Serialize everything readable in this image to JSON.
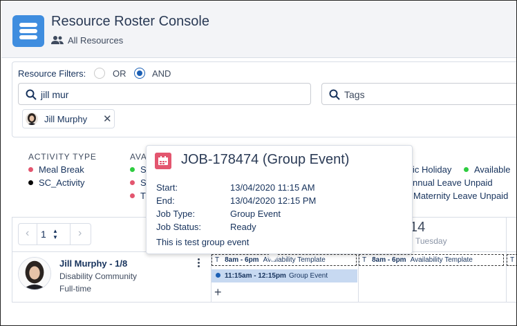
{
  "header": {
    "title": "Resource Roster Console",
    "subtitle": "All Resources"
  },
  "filters": {
    "label": "Resource Filters:",
    "options": [
      {
        "label": "OR",
        "selected": false
      },
      {
        "label": "AND",
        "selected": true
      }
    ],
    "search": {
      "value": "jill mur"
    },
    "tags": {
      "placeholder": "Tags"
    },
    "selected_resource": "Jill Murphy"
  },
  "legend": {
    "activity_type_heading": "ACTIVITY TYPE",
    "activity_types": [
      {
        "label": "Meal Break",
        "color": "#e3566f"
      },
      {
        "label": "SC_Activity",
        "color": "#080707"
      }
    ],
    "availability_heading_partial": "AVA",
    "availability_partial": [
      {
        "label": "S",
        "color": "#2ecc40"
      },
      {
        "label": "S",
        "color": "#e3566f"
      },
      {
        "label": "T",
        "color": "#e3566f"
      }
    ],
    "right_items": [
      {
        "label": "ic Holiday",
        "color": null
      },
      {
        "label": "Available",
        "color": "#2ecc40"
      },
      {
        "label": "nnual Leave Unpaid",
        "color": null
      },
      {
        "label": "Maternity Leave Unpaid",
        "color": "#e3566f"
      }
    ]
  },
  "pager": {
    "value": "1"
  },
  "day": {
    "number": "14",
    "name": "Tuesday"
  },
  "resource": {
    "name": "Jill Murphy - 1/8",
    "department": "Disability Community",
    "employment": "Full-time"
  },
  "availability_blocks": [
    {
      "type": "T",
      "time": "8am - 6pm",
      "label": "Availability Template"
    },
    {
      "type": "T",
      "time": "8am - 6pm",
      "label": "Availability Template"
    },
    {
      "type": "T",
      "time": "",
      "label": ""
    }
  ],
  "event": {
    "time": "11:15am - 12:15pm",
    "label": "Group Event",
    "color": "#1b5fb4"
  },
  "add_label": "+",
  "popover": {
    "title": "JOB-178474 (Group Event)",
    "fields": [
      {
        "label": "Start:",
        "value": "13/04/2020 11:15 AM"
      },
      {
        "label": "End:",
        "value": "13/04/2020 12:15 PM"
      },
      {
        "label": "Job Type:",
        "value": "Group Event"
      },
      {
        "label": "Job Status:",
        "value": "Ready"
      }
    ],
    "description": "This is test group event"
  }
}
